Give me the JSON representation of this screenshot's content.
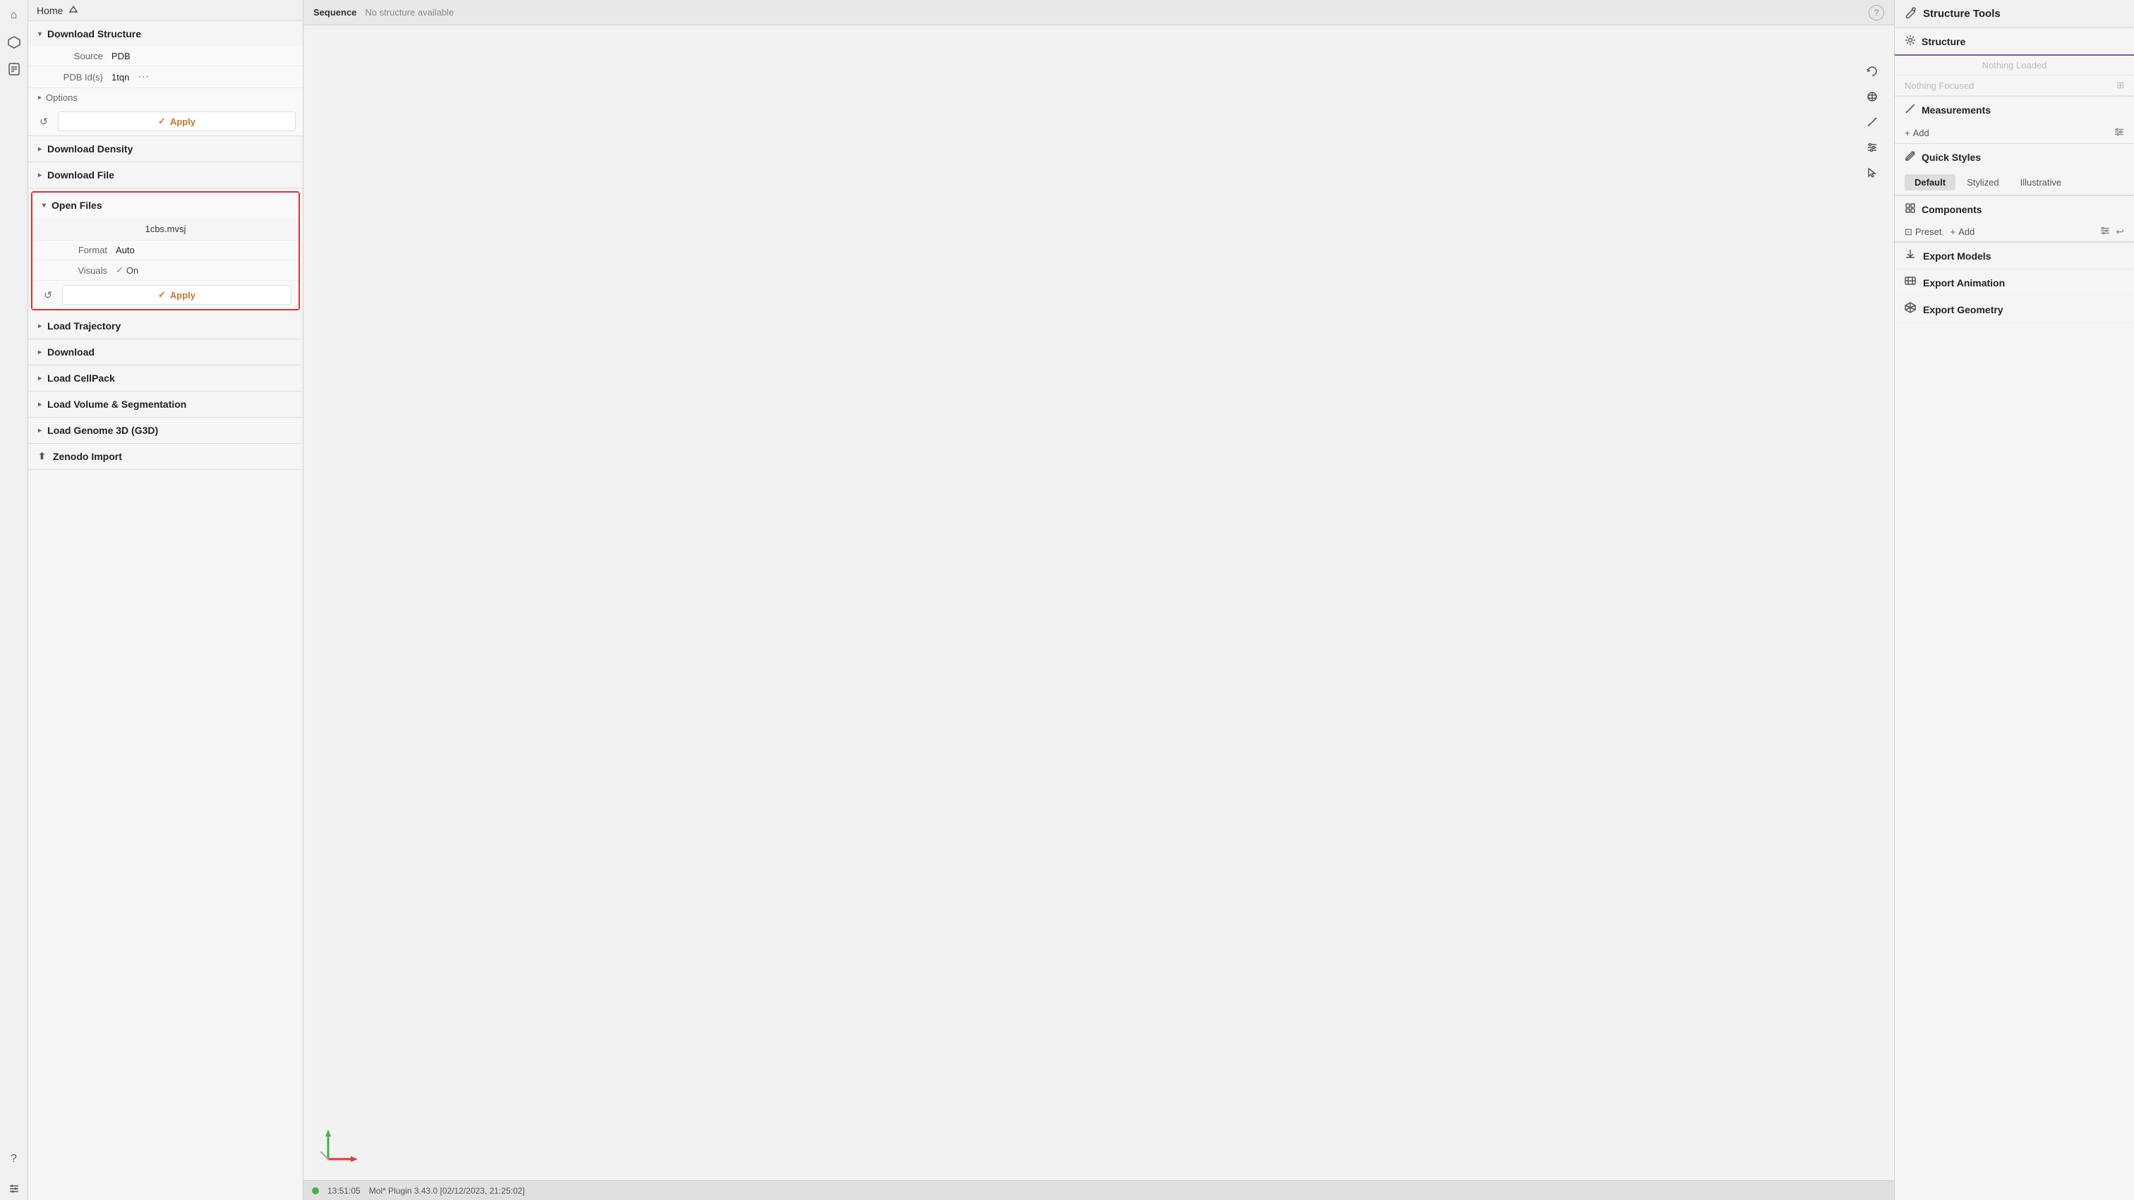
{
  "iconBar": {
    "icons": [
      "🏠",
      "⬡",
      "📄",
      "❓"
    ]
  },
  "leftPanel": {
    "header": "Home",
    "sections": {
      "downloadStructure": {
        "label": "Download Structure",
        "expanded": true,
        "source": {
          "label": "Source",
          "value": "PDB"
        },
        "pdbId": {
          "label": "PDB Id(s)",
          "value": "1tqn"
        },
        "options": {
          "label": "Options"
        },
        "applyBtn": "Apply",
        "resetBtn": "↺"
      },
      "downloadDensity": {
        "label": "Download Density",
        "expanded": false
      },
      "downloadFile": {
        "label": "Download File",
        "expanded": false
      },
      "openFiles": {
        "label": "Open Files",
        "expanded": true,
        "filename": "1cbs.mvsj",
        "format": {
          "label": "Format",
          "value": "Auto"
        },
        "visuals": {
          "label": "Visuals",
          "value": "On"
        },
        "applyBtn": "Apply",
        "resetBtn": "↺"
      },
      "loadTrajectory": {
        "label": "Load Trajectory",
        "expanded": false
      },
      "download": {
        "label": "Download",
        "expanded": false
      },
      "loadCellPack": {
        "label": "Load CellPack",
        "expanded": false
      },
      "loadVolumeSegmentation": {
        "label": "Load Volume & Segmentation",
        "expanded": false
      },
      "loadGenome3D": {
        "label": "Load Genome 3D (G3D)",
        "expanded": false
      },
      "zenodoImport": {
        "label": "Zenodo Import",
        "expanded": false
      }
    }
  },
  "viewport": {
    "sequenceLabel": "Sequence",
    "noStructure": "No structure available",
    "footerTime": "13:51:05",
    "footerVersion": "Mol* Plugin 3.43.0 [02/12/2023, 21:25:02]"
  },
  "rightPanel": {
    "title": "Structure Tools",
    "sections": {
      "structure": {
        "label": "Structure",
        "nothingLoaded": "Nothing Loaded",
        "nothingFocused": "Nothing Focused"
      },
      "measurements": {
        "label": "Measurements",
        "addLabel": "Add"
      },
      "quickStyles": {
        "label": "Quick Styles",
        "tabs": [
          "Default",
          "Stylized",
          "Illustrative"
        ],
        "activeTab": "Default"
      },
      "components": {
        "label": "Components",
        "presetLabel": "Preset",
        "addLabel": "Add"
      },
      "exportModels": {
        "label": "Export Models"
      },
      "exportAnimation": {
        "label": "Export Animation"
      },
      "exportGeometry": {
        "label": "Export Geometry"
      }
    }
  },
  "icons": {
    "home": "⌂",
    "structure": "⬡",
    "file": "📄",
    "help": "?",
    "wrench": "🔧",
    "gear": "⚙",
    "ruler": "📐",
    "sparkle": "✦",
    "cube": "⬡",
    "download": "⬇",
    "film": "🎬",
    "triangle": "△",
    "refresh": "↺",
    "check": "✓",
    "plus": "+",
    "settings": "⚙",
    "undo": "↩",
    "chevronDown": "▾",
    "chevronRight": "▸",
    "expand": "⊞",
    "close": "✕",
    "preset": "⊡"
  }
}
